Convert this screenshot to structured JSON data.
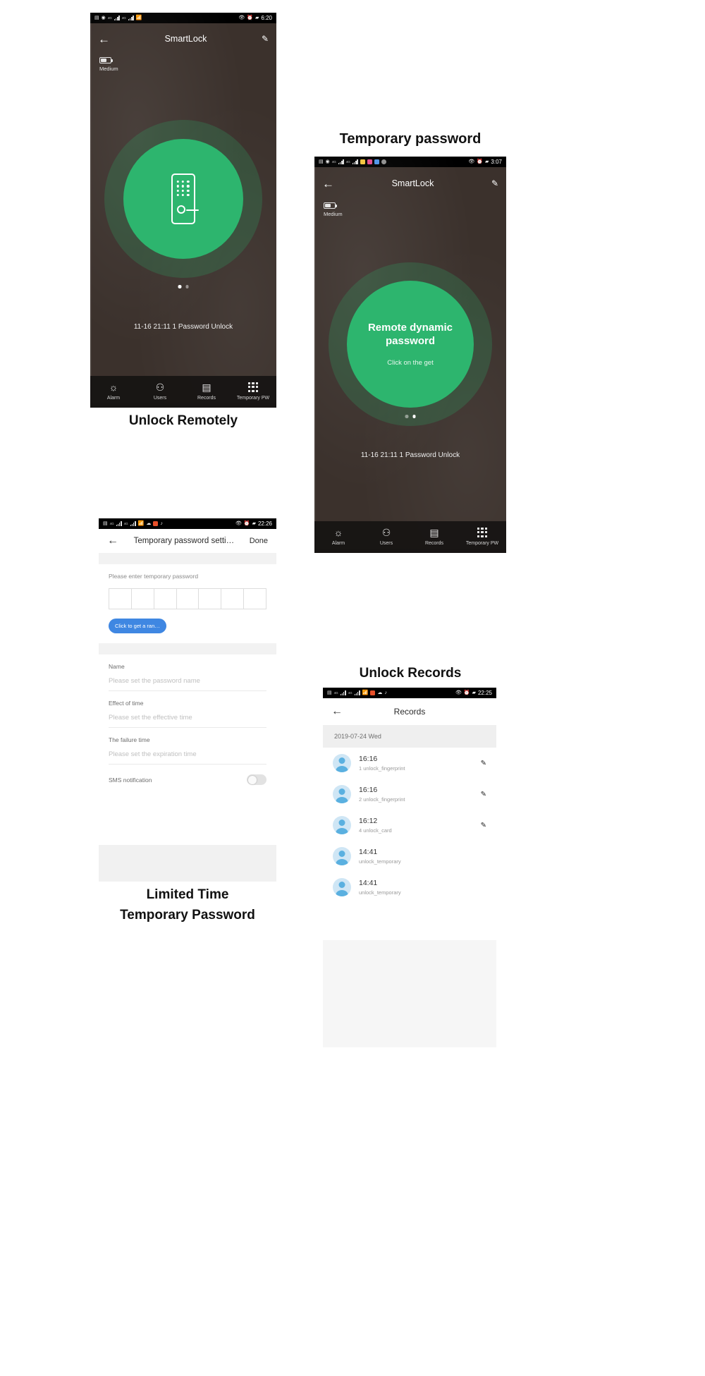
{
  "captions": {
    "unlock_remotely": "Unlock Remotely",
    "temporary_password": "Temporary password",
    "limited_line1": "Limited Time",
    "limited_line2": "Temporary Password",
    "unlock_records": "Unlock Records"
  },
  "screen_unlock": {
    "status": {
      "time": "6:20",
      "signal_label": "4G"
    },
    "appbar": {
      "back_icon": "arrow-left-icon",
      "title": "SmartLock",
      "edit_icon": "pencil-icon"
    },
    "battery": {
      "label": "Medium"
    },
    "lock_glyph": "smart-lock-device-icon",
    "page_dots": [
      true,
      false
    ],
    "record_line": "11-16 21:11  1 Password Unlock",
    "tabs": [
      {
        "icon": "alarm-icon",
        "label": "Alarm"
      },
      {
        "icon": "users-icon",
        "label": "Users"
      },
      {
        "icon": "calendar-icon",
        "label": "Records"
      },
      {
        "icon": "grid-icon",
        "label": "Temporary PW"
      }
    ]
  },
  "screen_dynamic": {
    "status": {
      "time": "3:07"
    },
    "appbar": {
      "back_icon": "arrow-left-icon",
      "title": "SmartLock",
      "edit_icon": "pencil-icon"
    },
    "battery": {
      "label": "Medium"
    },
    "button_title": "Remote dynamic password",
    "button_sub": "Click on the get",
    "page_dots": [
      false,
      true
    ],
    "record_line": "11-16 21:11  1 Password Unlock",
    "tabs": [
      {
        "icon": "alarm-icon",
        "label": "Alarm"
      },
      {
        "icon": "users-icon",
        "label": "Users"
      },
      {
        "icon": "calendar-icon",
        "label": "Records"
      },
      {
        "icon": "grid-icon",
        "label": "Temporary PW"
      }
    ]
  },
  "screen_settings": {
    "status": {
      "time": "22:26"
    },
    "appbar": {
      "back_icon": "arrow-left-icon",
      "title": "Temporary password setti…",
      "done": "Done"
    },
    "password_hint": "Please enter temporary password",
    "password_cells": [
      "",
      "",
      "",
      "",
      "",
      "",
      ""
    ],
    "random_button": "Click to get a ran…",
    "fields": [
      {
        "label": "Name",
        "placeholder": "Please set the password name"
      },
      {
        "label": "Effect of time",
        "placeholder": "Please set the effective time"
      },
      {
        "label": "The failure time",
        "placeholder": "Please set the expiration time"
      }
    ],
    "sms": {
      "label": "SMS notification",
      "on": false
    }
  },
  "screen_records": {
    "status": {
      "time": "22:25"
    },
    "appbar": {
      "back_icon": "arrow-left-icon",
      "title": "Records"
    },
    "date_header": "2019-07-24 Wed",
    "rows": [
      {
        "time": "16:16",
        "detail": "1 unlock_fingerprint",
        "edit": true
      },
      {
        "time": "16:16",
        "detail": "2 unlock_fingerprint",
        "edit": true
      },
      {
        "time": "16:12",
        "detail": "4 unlock_card",
        "edit": true
      },
      {
        "time": "14:41",
        "detail": "unlock_temporary",
        "edit": false
      },
      {
        "time": "14:41",
        "detail": "unlock_temporary",
        "edit": false
      }
    ]
  },
  "colors": {
    "green": "#2db56e",
    "blue": "#3f87e2",
    "avatar": "#5ab0e0"
  }
}
